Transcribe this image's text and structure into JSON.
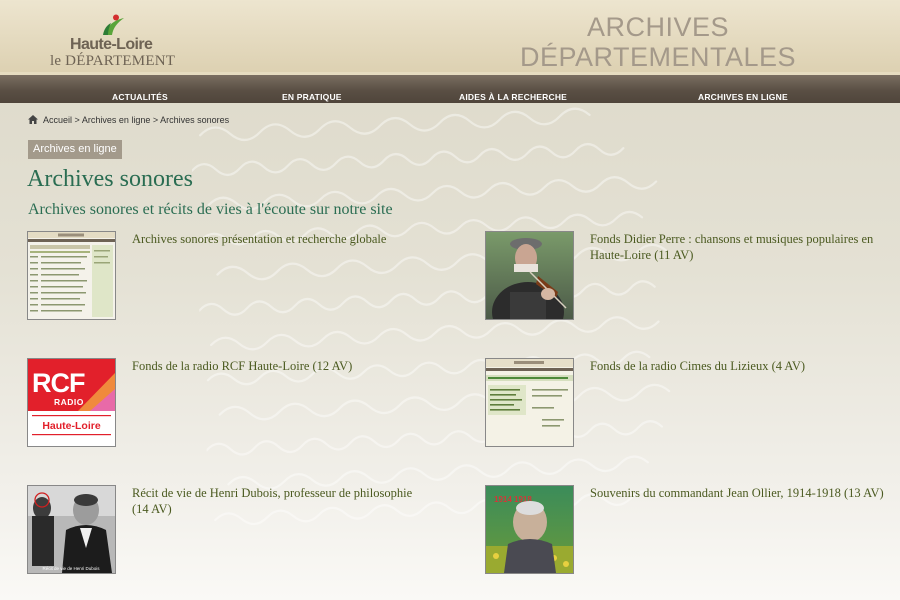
{
  "header": {
    "logo_name": "Haute-Loire",
    "logo_sub": "le DÉPARTEMENT",
    "title_line1": "ARCHIVES",
    "title_line2": "DÉPARTEMENTALES"
  },
  "nav": {
    "items": [
      {
        "label": "ACTUALITÉS"
      },
      {
        "label": "EN PRATIQUE"
      },
      {
        "label": "AIDES À LA RECHERCHE"
      },
      {
        "label": "ARCHIVES EN LIGNE"
      }
    ]
  },
  "breadcrumb": {
    "items": [
      "Accueil",
      "Archives en ligne",
      "Archives sonores"
    ],
    "separator": ">"
  },
  "section_chip": "Archives en ligne",
  "page_title": "Archives sonores",
  "subtitle": "Archives sonores et récits de vies à l'écoute sur notre site",
  "thumbs": {
    "rcf_big": "RCF",
    "rcf_small": "RADIO",
    "rcf_place": "Haute-Loire",
    "ollier_years": "1914 1918",
    "dubois_caption": "Récit de vie de Henri Dubois"
  },
  "items": [
    {
      "title": "Archives sonores présentation et recherche globale"
    },
    {
      "title": "Fonds Didier Perre : chansons et musiques populaires en Haute-Loire (11 AV)"
    },
    {
      "title": "Fonds de la radio RCF Haute-Loire (12 AV)"
    },
    {
      "title": "Fonds de la radio Cimes du Lizieux (4 AV)"
    },
    {
      "title": "Récit de vie de Henri Dubois, professeur de philosophie (14 AV)"
    },
    {
      "title": "Souvenirs du commandant Jean Ollier, 1914-1918 (13 AV)"
    }
  ],
  "colors": {
    "accent_green": "#2a6d52",
    "link_olive": "#4b5a20",
    "nav_brown": "#5a4f44",
    "rcf_red": "#e2202b"
  }
}
